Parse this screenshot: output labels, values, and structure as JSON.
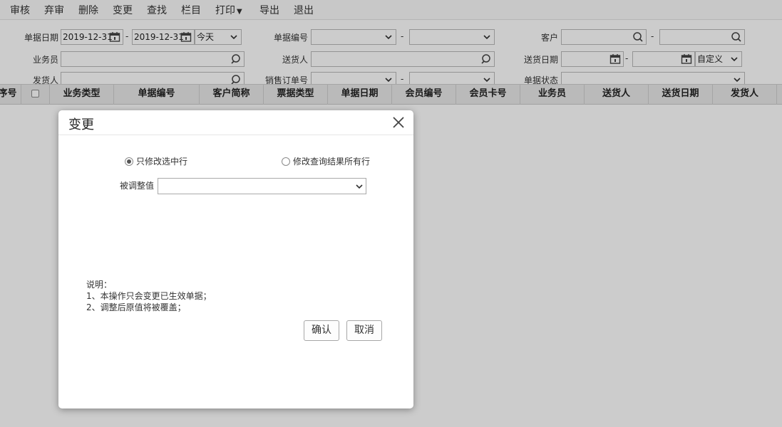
{
  "toolbar": {
    "items": [
      "审核",
      "弃审",
      "删除",
      "变更",
      "查找",
      "栏目",
      "打印",
      "导出",
      "退出"
    ]
  },
  "filters": {
    "bill_date_label": "单据日期",
    "bill_date_from": "2019-12-31",
    "bill_date_to": "2019-12-31",
    "bill_date_range": "今天",
    "bill_no_label": "单据编号",
    "customer_label": "客户",
    "salesman_label": "业务员",
    "deliverer_label": "送货人",
    "delivery_date_label": "送货日期",
    "delivery_date_range": "自定义",
    "shipper_label": "发货人",
    "sales_order_label": "销售订单号",
    "bill_status_label": "单据状态",
    "range_separator": "-"
  },
  "table": {
    "columns": [
      "序号",
      "",
      "业务类型",
      "单据编号",
      "客户简称",
      "票据类型",
      "单据日期",
      "会员编号",
      "会员卡号",
      "业务员",
      "送货人",
      "送货日期",
      "发货人"
    ]
  },
  "dialog": {
    "title": "变更",
    "radio_selected_rows": "只修改选中行",
    "radio_all_rows": "修改查询结果所有行",
    "adjust_label": "被调整值",
    "adjust_value": "",
    "notes": [
      "说明：",
      "1、本操作只会变更已生效单据；",
      "2、调整后原值将被覆盖；"
    ],
    "confirm_label": "确认",
    "cancel_label": "取消"
  },
  "colors": {
    "overlay": "rgba(0,0,0,0.2)",
    "header_bg": "#e9e9e9"
  }
}
